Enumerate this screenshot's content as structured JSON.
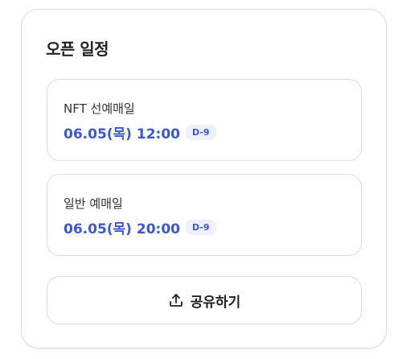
{
  "section": {
    "title": "오픈 일정"
  },
  "schedule": [
    {
      "label": "NFT 선예매일",
      "date": "06.05(목) 12:00",
      "dday": "D-9"
    },
    {
      "label": "일반 예매일",
      "date": "06.05(목) 20:00",
      "dday": "D-9"
    }
  ],
  "share": {
    "label": "공유하기",
    "icon": "share-upload-icon"
  },
  "colors": {
    "accent": "#3c57d6",
    "badge_bg": "#eef1fd",
    "border": "#dcdcdc"
  }
}
